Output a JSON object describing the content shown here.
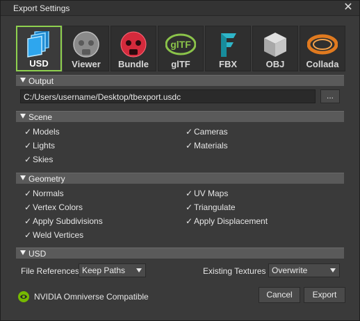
{
  "window": {
    "title": "Export Settings",
    "close_label": "✕"
  },
  "formats": [
    {
      "label": "USD",
      "icon": "usd-icon",
      "active": true
    },
    {
      "label": "Viewer",
      "icon": "viewer-icon",
      "active": false
    },
    {
      "label": "Bundle",
      "icon": "bundle-icon",
      "active": false
    },
    {
      "label": "glTF",
      "icon": "gltf-icon",
      "active": false
    },
    {
      "label": "FBX",
      "icon": "fbx-icon",
      "active": false
    },
    {
      "label": "OBJ",
      "icon": "obj-icon",
      "active": false
    },
    {
      "label": "Collada",
      "icon": "collada-icon",
      "active": false
    }
  ],
  "output": {
    "header": "Output",
    "path": "C:/Users/username/Desktop/tbexport.usdc",
    "browse_label": "..."
  },
  "scene": {
    "header": "Scene",
    "left": [
      "Models",
      "Lights",
      "Skies"
    ],
    "right": [
      "Cameras",
      "Materials"
    ]
  },
  "geometry": {
    "header": "Geometry",
    "left": [
      "Normals",
      "Vertex Colors",
      "Apply Subdivisions",
      "Weld Vertices"
    ],
    "right": [
      "UV Maps",
      "Triangulate",
      "Apply Displacement"
    ]
  },
  "usd": {
    "header": "USD",
    "file_refs_label": "File References",
    "file_refs_value": "Keep Paths",
    "textures_label": "Existing Textures",
    "textures_value": "Overwrite"
  },
  "footer": {
    "compat_text": "NVIDIA Omniverse Compatible",
    "cancel_label": "Cancel",
    "export_label": "Export"
  },
  "colors": {
    "accent": "#8fd14f",
    "nvidia_green": "#76b900"
  }
}
